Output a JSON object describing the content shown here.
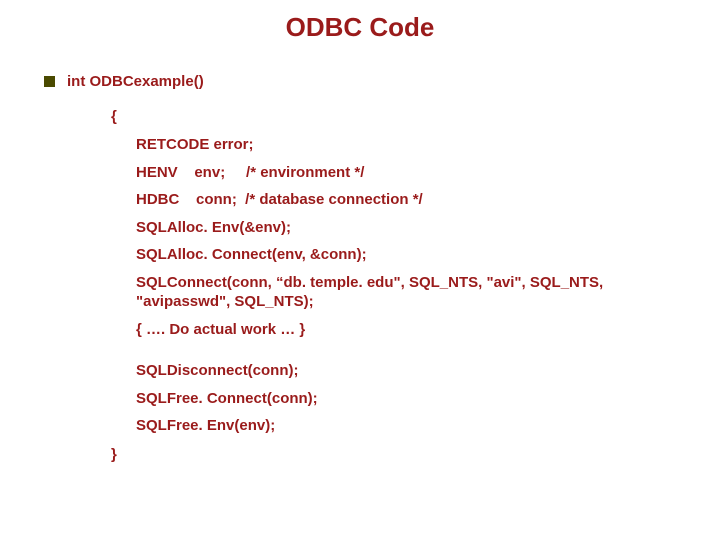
{
  "title": "ODBC Code",
  "func_signature": "int ODBCexample()",
  "open_brace": "{",
  "lines": {
    "l1": "RETCODE error;",
    "l2": "HENV    env;     /* environment */",
    "l3": "HDBC    conn;  /* database connection */",
    "l4": "SQLAlloc. Env(&env);",
    "l5": "SQLAlloc. Connect(env, &conn);",
    "l6": "SQLConnect(conn, “db. temple. edu\", SQL_NTS, \"avi\", SQL_NTS, \"avipasswd\", SQL_NTS);",
    "l7": "{ …. Do actual work … }",
    "l8": "SQLDisconnect(conn);",
    "l9": "SQLFree. Connect(conn);",
    "l10": "SQLFree. Env(env);"
  },
  "close_brace": "}"
}
